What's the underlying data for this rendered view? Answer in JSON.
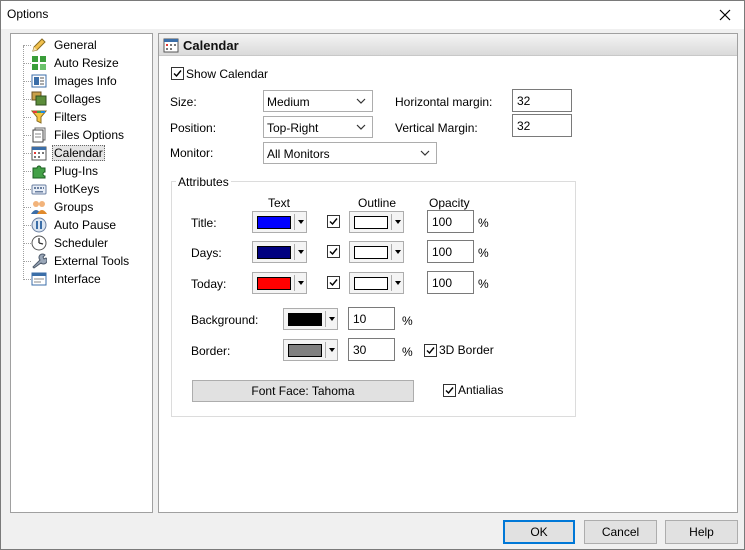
{
  "window": {
    "title": "Options"
  },
  "sidebar": {
    "items": [
      {
        "label": "General",
        "icon": "pencil-icon"
      },
      {
        "label": "Auto Resize",
        "icon": "auto-resize-icon"
      },
      {
        "label": "Images Info",
        "icon": "images-info-icon"
      },
      {
        "label": "Collages",
        "icon": "collages-icon"
      },
      {
        "label": "Filters",
        "icon": "filter-icon"
      },
      {
        "label": "Files Options",
        "icon": "files-icon"
      },
      {
        "label": "Calendar",
        "icon": "calendar-icon"
      },
      {
        "label": "Plug-Ins",
        "icon": "puzzle-icon"
      },
      {
        "label": "HotKeys",
        "icon": "keyboard-icon"
      },
      {
        "label": "Groups",
        "icon": "groups-icon"
      },
      {
        "label": "Auto Pause",
        "icon": "pause-icon"
      },
      {
        "label": "Scheduler",
        "icon": "clock-icon"
      },
      {
        "label": "External Tools",
        "icon": "wrench-icon"
      },
      {
        "label": "Interface",
        "icon": "interface-icon"
      }
    ],
    "selected": "Calendar"
  },
  "panel": {
    "title": "Calendar",
    "show_calendar": {
      "label": "Show Calendar",
      "checked": true
    },
    "size": {
      "label": "Size:",
      "value": "Medium"
    },
    "position": {
      "label": "Position:",
      "value": "Top-Right"
    },
    "monitor": {
      "label": "Monitor:",
      "value": "All Monitors"
    },
    "horizontal_margin": {
      "label": "Horizontal margin:",
      "value": "32"
    },
    "vertical_margin": {
      "label": "Vertical Margin:",
      "value": "32"
    },
    "attributes": {
      "title": "Attributes",
      "col_text": "Text",
      "col_outline": "Outline",
      "col_opacity": "Opacity",
      "rows": [
        {
          "label": "Title:",
          "text_color": "#0000ff",
          "outline_checked": true,
          "outline_color": "#ffffff",
          "opacity": "100",
          "unit": "%"
        },
        {
          "label": "Days:",
          "text_color": "#000080",
          "outline_checked": true,
          "outline_color": "#ffffff",
          "opacity": "100",
          "unit": "%"
        },
        {
          "label": "Today:",
          "text_color": "#ff0000",
          "outline_checked": true,
          "outline_color": "#ffffff",
          "opacity": "100",
          "unit": "%"
        }
      ],
      "background": {
        "label": "Background:",
        "color": "#000000",
        "value": "10",
        "unit": "%"
      },
      "border": {
        "label": "Border:",
        "color": "#808080",
        "value": "30",
        "unit": "%"
      },
      "border_3d": {
        "label": "3D Border",
        "checked": true
      },
      "font_face_button": "Font Face: Tahoma",
      "antialias": {
        "label": "Antialias",
        "checked": true
      }
    }
  },
  "buttons": {
    "ok": "OK",
    "cancel": "Cancel",
    "help": "Help"
  }
}
